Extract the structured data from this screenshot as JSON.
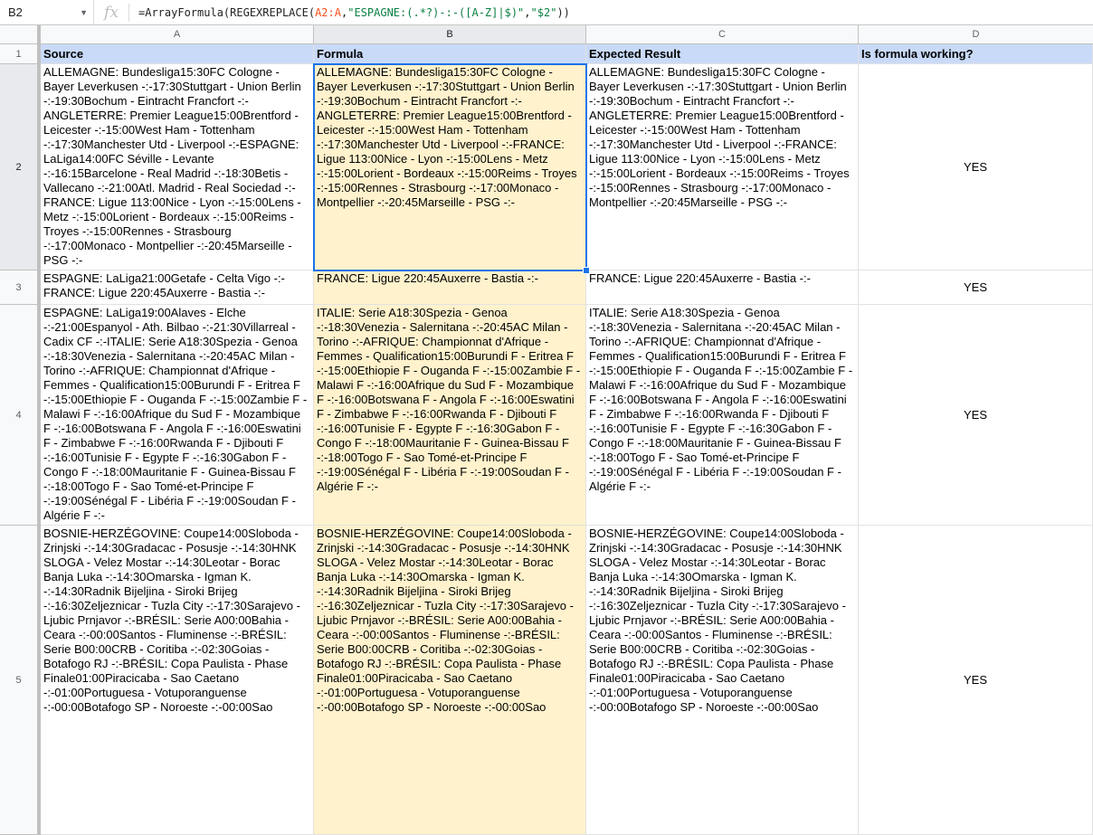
{
  "formula_bar": {
    "name_box": "B2",
    "fx_label": "fx",
    "formula_pre": "=ArrayFormula(REGEXREPLACE(",
    "formula_ref": "A2:A",
    "formula_mid": ",",
    "formula_regex": "\"ESPAGNE:(.*?)-:-([A-Z]|$)\"",
    "formula_mid2": ",",
    "formula_repl": "\"$2\"",
    "formula_post": "))"
  },
  "columns": [
    "A",
    "B",
    "C",
    "D"
  ],
  "rows": [
    {
      "num": "1",
      "a": "Source",
      "b": "Formula",
      "c": "Expected Result",
      "d": "Is formula working?"
    },
    {
      "num": "2",
      "a": "ALLEMAGNE: Bundesliga15:30FC Cologne - Bayer Leverkusen -:-17:30Stuttgart - Union Berlin -:-19:30Bochum - Eintracht Francfort -:-ANGLETERRE: Premier League15:00Brentford - Leicester -:-15:00West Ham - Tottenham -:-17:30Manchester Utd - Liverpool -:-ESPAGNE: LaLiga14:00FC Séville - Levante -:-16:15Barcelone - Real Madrid -:-18:30Betis - Vallecano -:-21:00Atl. Madrid - Real Sociedad -:-FRANCE: Ligue 113:00Nice - Lyon -:-15:00Lens - Metz -:-15:00Lorient - Bordeaux -:-15:00Reims - Troyes -:-15:00Rennes - Strasbourg -:-17:00Monaco - Montpellier -:-20:45Marseille - PSG -:-",
      "b": "ALLEMAGNE: Bundesliga15:30FC Cologne - Bayer Leverkusen -:-17:30Stuttgart - Union Berlin -:-19:30Bochum - Eintracht Francfort -:-ANGLETERRE: Premier League15:00Brentford - Leicester -:-15:00West Ham - Tottenham -:-17:30Manchester Utd - Liverpool -:-FRANCE: Ligue 113:00Nice - Lyon -:-15:00Lens - Metz -:-15:00Lorient - Bordeaux -:-15:00Reims - Troyes -:-15:00Rennes - Strasbourg -:-17:00Monaco - Montpellier -:-20:45Marseille - PSG -:-",
      "c": "ALLEMAGNE: Bundesliga15:30FC Cologne - Bayer Leverkusen -:-17:30Stuttgart - Union Berlin -:-19:30Bochum - Eintracht Francfort -:-ANGLETERRE: Premier League15:00Brentford - Leicester -:-15:00West Ham - Tottenham -:-17:30Manchester Utd - Liverpool -:-FRANCE: Ligue 113:00Nice - Lyon -:-15:00Lens - Metz -:-15:00Lorient - Bordeaux -:-15:00Reims - Troyes -:-15:00Rennes - Strasbourg -:-17:00Monaco - Montpellier -:-20:45Marseille - PSG -:-",
      "d": "YES"
    },
    {
      "num": "3",
      "a": "ESPAGNE: LaLiga21:00Getafe - Celta Vigo -:-FRANCE: Ligue 220:45Auxerre - Bastia -:-",
      "b": "FRANCE: Ligue 220:45Auxerre - Bastia -:-",
      "c": "FRANCE: Ligue 220:45Auxerre - Bastia -:-",
      "d": "YES"
    },
    {
      "num": "4",
      "a": "ESPAGNE: LaLiga19:00Alaves - Elche -:-21:00Espanyol - Ath. Bilbao -:-21:30Villarreal - Cadix CF -:-ITALIE: Serie A18:30Spezia - Genoa -:-18:30Venezia - Salernitana -:-20:45AC Milan - Torino -:-AFRIQUE: Championnat d'Afrique - Femmes - Qualification15:00Burundi F - Eritrea F -:-15:00Ethiopie F - Ouganda F -:-15:00Zambie F - Malawi F -:-16:00Afrique du Sud F - Mozambique F -:-16:00Botswana F - Angola F -:-16:00Eswatini F - Zimbabwe F -:-16:00Rwanda F - Djibouti F -:-16:00Tunisie F - Egypte F -:-16:30Gabon F - Congo F -:-18:00Mauritanie F - Guinea-Bissau F -:-18:00Togo F - Sao Tomé-et-Principe F -:-19:00Sénégal F - Libéria F -:-19:00Soudan F - Algérie F -:-",
      "b": "ITALIE: Serie A18:30Spezia - Genoa -:-18:30Venezia - Salernitana -:-20:45AC Milan - Torino -:-AFRIQUE: Championnat d'Afrique - Femmes - Qualification15:00Burundi F - Eritrea F -:-15:00Ethiopie F - Ouganda F -:-15:00Zambie F - Malawi F -:-16:00Afrique du Sud F - Mozambique F -:-16:00Botswana F - Angola F -:-16:00Eswatini F - Zimbabwe F -:-16:00Rwanda F - Djibouti F -:-16:00Tunisie F - Egypte F -:-16:30Gabon F - Congo F -:-18:00Mauritanie F - Guinea-Bissau F -:-18:00Togo F - Sao Tomé-et-Principe F -:-19:00Sénégal F - Libéria F -:-19:00Soudan F - Algérie F -:-",
      "c": "ITALIE: Serie A18:30Spezia - Genoa -:-18:30Venezia - Salernitana -:-20:45AC Milan - Torino -:-AFRIQUE: Championnat d'Afrique - Femmes - Qualification15:00Burundi F - Eritrea F -:-15:00Ethiopie F - Ouganda F -:-15:00Zambie F - Malawi F -:-16:00Afrique du Sud F - Mozambique F -:-16:00Botswana F - Angola F -:-16:00Eswatini F - Zimbabwe F -:-16:00Rwanda F - Djibouti F -:-16:00Tunisie F - Egypte F -:-16:30Gabon F - Congo F -:-18:00Mauritanie F - Guinea-Bissau F -:-18:00Togo F - Sao Tomé-et-Principe F -:-19:00Sénégal F - Libéria F -:-19:00Soudan F - Algérie F -:-",
      "d": "YES"
    },
    {
      "num": "5",
      "a": "BOSNIE-HERZÉGOVINE: Coupe14:00Sloboda - Zrinjski -:-14:30Gradacac - Posusje -:-14:30HNK SLOGA - Velez Mostar -:-14:30Leotar - Borac Banja Luka -:-14:30Omarska - Igman K. -:-14:30Radnik Bijeljina - Siroki Brijeg -:-16:30Zeljeznicar - Tuzla City -:-17:30Sarajevo - Ljubic Prnjavor -:-BRÉSIL: Serie A00:00Bahia - Ceara -:-00:00Santos - Fluminense -:-BRÉSIL: Serie B00:00CRB - Coritiba -:-02:30Goias - Botafogo RJ -:-BRÉSIL: Copa Paulista - Phase Finale01:00Piracicaba - Sao Caetano -:-01:00Portuguesa - Votuporanguense -:-00:00Botafogo SP - Noroeste -:-00:00Sao",
      "b": "BOSNIE-HERZÉGOVINE: Coupe14:00Sloboda - Zrinjski -:-14:30Gradacac - Posusje -:-14:30HNK SLOGA - Velez Mostar -:-14:30Leotar - Borac Banja Luka -:-14:30Omarska - Igman K. -:-14:30Radnik Bijeljina - Siroki Brijeg -:-16:30Zeljeznicar - Tuzla City -:-17:30Sarajevo - Ljubic Prnjavor -:-BRÉSIL: Serie A00:00Bahia - Ceara -:-00:00Santos - Fluminense -:-BRÉSIL: Serie B00:00CRB - Coritiba -:-02:30Goias - Botafogo RJ -:-BRÉSIL: Copa Paulista - Phase Finale01:00Piracicaba - Sao Caetano -:-01:00Portuguesa - Votuporanguense -:-00:00Botafogo SP - Noroeste -:-00:00Sao",
      "c": "BOSNIE-HERZÉGOVINE: Coupe14:00Sloboda - Zrinjski -:-14:30Gradacac - Posusje -:-14:30HNK SLOGA - Velez Mostar -:-14:30Leotar - Borac Banja Luka -:-14:30Omarska - Igman K. -:-14:30Radnik Bijeljina - Siroki Brijeg -:-16:30Zeljeznicar - Tuzla City -:-17:30Sarajevo - Ljubic Prnjavor -:-BRÉSIL: Serie A00:00Bahia - Ceara -:-00:00Santos - Fluminense -:-BRÉSIL: Serie B00:00CRB - Coritiba -:-02:30Goias - Botafogo RJ -:-BRÉSIL: Copa Paulista - Phase Finale01:00Piracicaba - Sao Caetano -:-01:00Portuguesa - Votuporanguense -:-00:00Botafogo SP - Noroeste -:-00:00Sao",
      "d": "YES"
    }
  ],
  "colors": {
    "header_fill": "#c9daf8",
    "formula_col_fill": "#fff2cc",
    "selection": "#1a73e8"
  }
}
